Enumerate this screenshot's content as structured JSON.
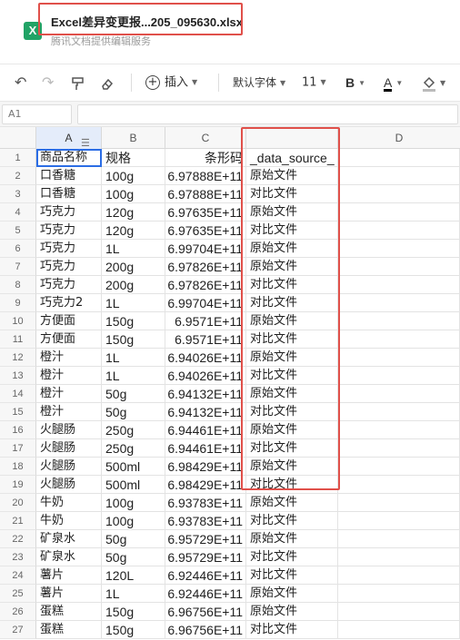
{
  "file": {
    "title": "Excel差异变更报...205_095630.xlsx",
    "subtitle": "腾讯文档提供编辑服务",
    "icon_letter": "X"
  },
  "toolbar": {
    "insert_label": "插入",
    "font_label": "默认字体",
    "size_label": "11",
    "bold_label": "B",
    "font_color_label": "A"
  },
  "formula_bar": {
    "cell_ref": "A1",
    "formula": ""
  },
  "columns": [
    "A",
    "B",
    "C",
    "D"
  ],
  "rows": [
    {
      "n": "1",
      "a": "商品名称",
      "b": "规格",
      "c": "条形码",
      "d": "_data_source_"
    },
    {
      "n": "2",
      "a": "口香糖",
      "b": "100g",
      "c": "6.97888E+11",
      "d": "原始文件"
    },
    {
      "n": "3",
      "a": "口香糖",
      "b": "100g",
      "c": "6.97888E+11",
      "d": "对比文件"
    },
    {
      "n": "4",
      "a": "巧克力",
      "b": "120g",
      "c": "6.97635E+11",
      "d": "原始文件"
    },
    {
      "n": "5",
      "a": "巧克力",
      "b": "120g",
      "c": "6.97635E+11",
      "d": "对比文件"
    },
    {
      "n": "6",
      "a": "巧克力",
      "b": "1L",
      "c": "6.99704E+11",
      "d": "原始文件"
    },
    {
      "n": "7",
      "a": "巧克力",
      "b": "200g",
      "c": "6.97826E+11",
      "d": "原始文件"
    },
    {
      "n": "8",
      "a": "巧克力",
      "b": "200g",
      "c": "6.97826E+11",
      "d": "对比文件"
    },
    {
      "n": "9",
      "a": "巧克力2",
      "b": "1L",
      "c": "6.99704E+11",
      "d": "对比文件"
    },
    {
      "n": "10",
      "a": "方便面",
      "b": "150g",
      "c": "6.9571E+11",
      "d": "原始文件"
    },
    {
      "n": "11",
      "a": "方便面",
      "b": "150g",
      "c": "6.9571E+11",
      "d": "对比文件"
    },
    {
      "n": "12",
      "a": "橙汁",
      "b": "1L",
      "c": "6.94026E+11",
      "d": "原始文件"
    },
    {
      "n": "13",
      "a": "橙汁",
      "b": "1L",
      "c": "6.94026E+11",
      "d": "对比文件"
    },
    {
      "n": "14",
      "a": "橙汁",
      "b": "50g",
      "c": "6.94132E+11",
      "d": "原始文件"
    },
    {
      "n": "15",
      "a": "橙汁",
      "b": "50g",
      "c": "6.94132E+11",
      "d": "对比文件"
    },
    {
      "n": "16",
      "a": "火腿肠",
      "b": "250g",
      "c": "6.94461E+11",
      "d": "原始文件"
    },
    {
      "n": "17",
      "a": "火腿肠",
      "b": "250g",
      "c": "6.94461E+11",
      "d": "对比文件"
    },
    {
      "n": "18",
      "a": "火腿肠",
      "b": "500ml",
      "c": "6.98429E+11",
      "d": "原始文件"
    },
    {
      "n": "19",
      "a": "火腿肠",
      "b": "500ml",
      "c": "6.98429E+11",
      "d": "对比文件"
    },
    {
      "n": "20",
      "a": "牛奶",
      "b": "100g",
      "c": "6.93783E+11",
      "d": "原始文件"
    },
    {
      "n": "21",
      "a": "牛奶",
      "b": "100g",
      "c": "6.93783E+11",
      "d": "对比文件"
    },
    {
      "n": "22",
      "a": "矿泉水",
      "b": "50g",
      "c": "6.95729E+11",
      "d": "原始文件"
    },
    {
      "n": "23",
      "a": "矿泉水",
      "b": "50g",
      "c": "6.95729E+11",
      "d": "对比文件"
    },
    {
      "n": "24",
      "a": "薯片",
      "b": "120L",
      "c": "6.92446E+11",
      "d": "对比文件"
    },
    {
      "n": "25",
      "a": "薯片",
      "b": "1L",
      "c": "6.92446E+11",
      "d": "原始文件"
    },
    {
      "n": "26",
      "a": "蛋糕",
      "b": "150g",
      "c": "6.96756E+11",
      "d": "原始文件"
    },
    {
      "n": "27",
      "a": "蛋糕",
      "b": "150g",
      "c": "6.96756E+11",
      "d": "对比文件"
    }
  ],
  "colors": {
    "highlight": "#e0504a",
    "selection": "#2b6de5",
    "brand": "#21a366"
  }
}
